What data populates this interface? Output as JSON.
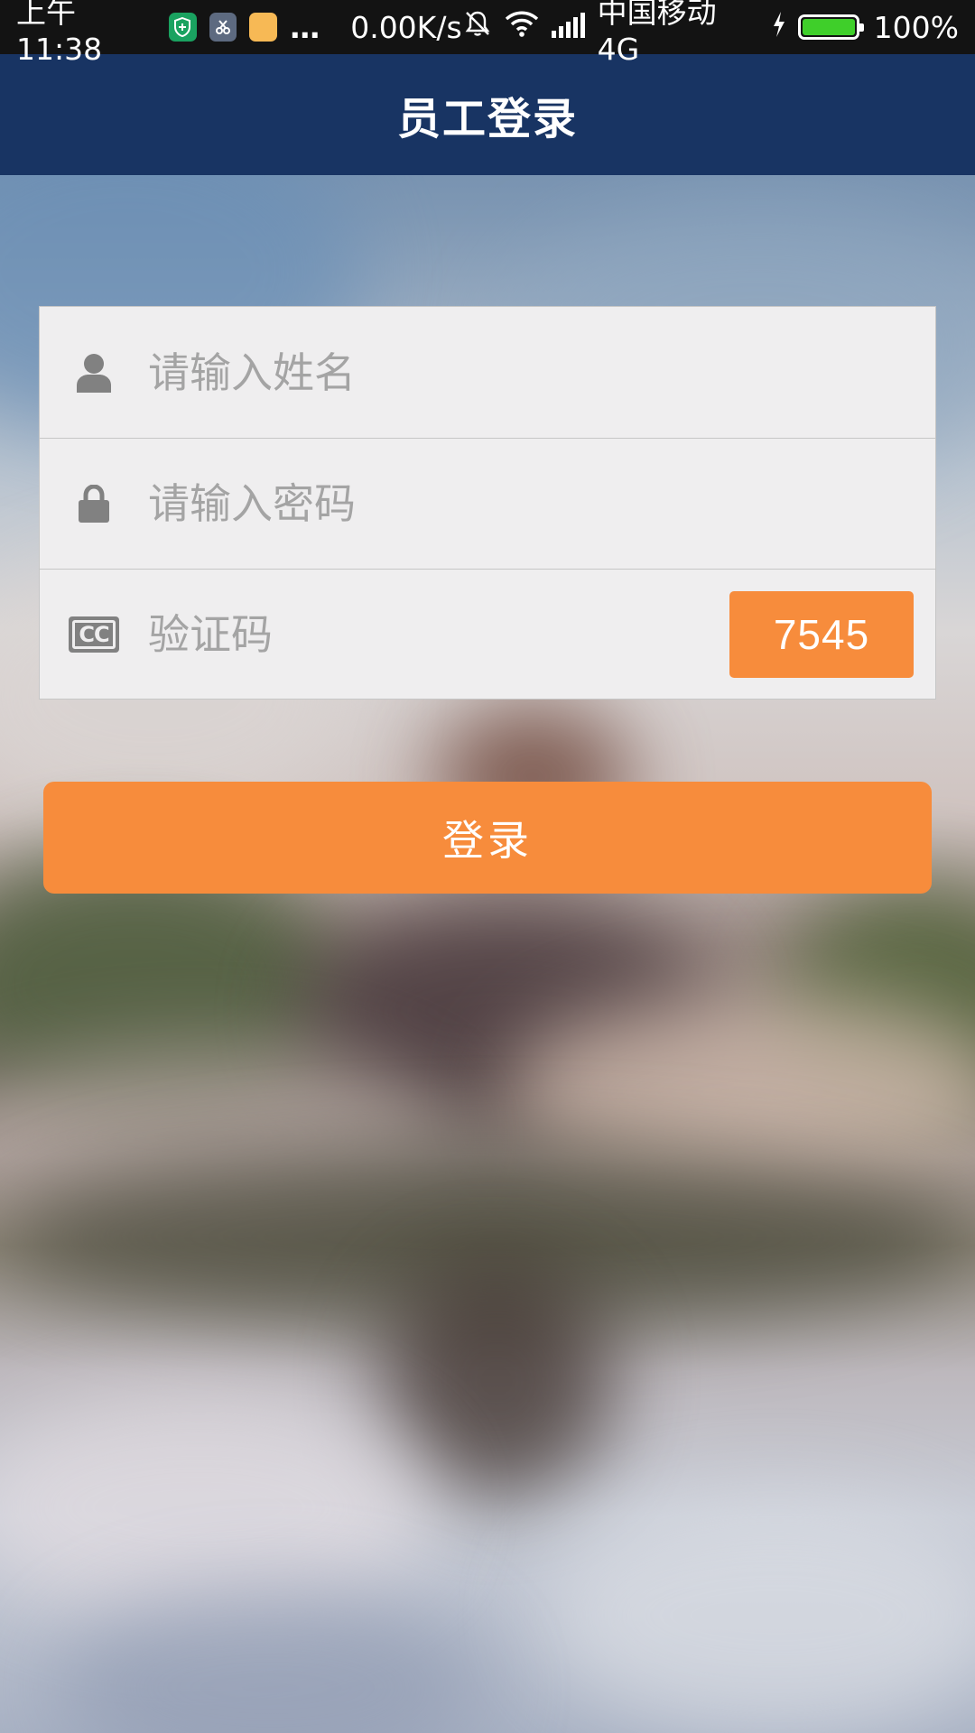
{
  "status_bar": {
    "time": "上午11:38",
    "more": "…",
    "net_speed": "0.00K/s",
    "carrier": "中国移动 4G",
    "battery": "100%",
    "battery_level": 1.0
  },
  "header": {
    "title": "员工登录"
  },
  "form": {
    "name_placeholder": "请输入姓名",
    "password_placeholder": "请输入密码",
    "captcha_placeholder": "验证码",
    "captcha_code": "7545",
    "cc_icon_text": "CC"
  },
  "login_button": {
    "label": "登录"
  },
  "colors": {
    "accent": "#f78c3c",
    "header_bg": "#183463",
    "status_bg": "#131313",
    "form_bg": "#efeeef",
    "icon_gray": "#818181"
  },
  "icons": {
    "name": "user-icon",
    "password": "lock-icon",
    "captcha": "closed-caption-icon"
  }
}
